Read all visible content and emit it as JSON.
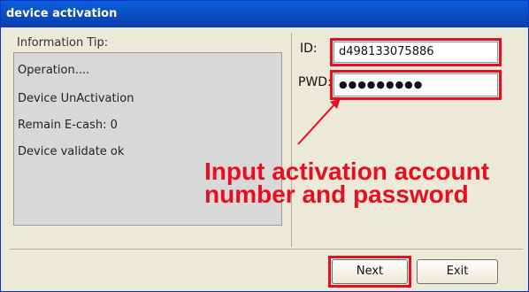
{
  "window": {
    "title": "device activation"
  },
  "info": {
    "label": "Information Tip:",
    "lines": [
      "Operation....",
      "Device UnActivation",
      "Remain E-cash: 0",
      "Device validate ok"
    ]
  },
  "form": {
    "id_label": "ID:",
    "id_value": "d498133075886",
    "pwd_label": "PWD:",
    "pwd_value": "●●●●●●●●●"
  },
  "annotation": {
    "line1": "Input activation account",
    "line2": "number and password",
    "color": "#e60f1f"
  },
  "buttons": {
    "next": "Next",
    "exit": "Exit"
  }
}
